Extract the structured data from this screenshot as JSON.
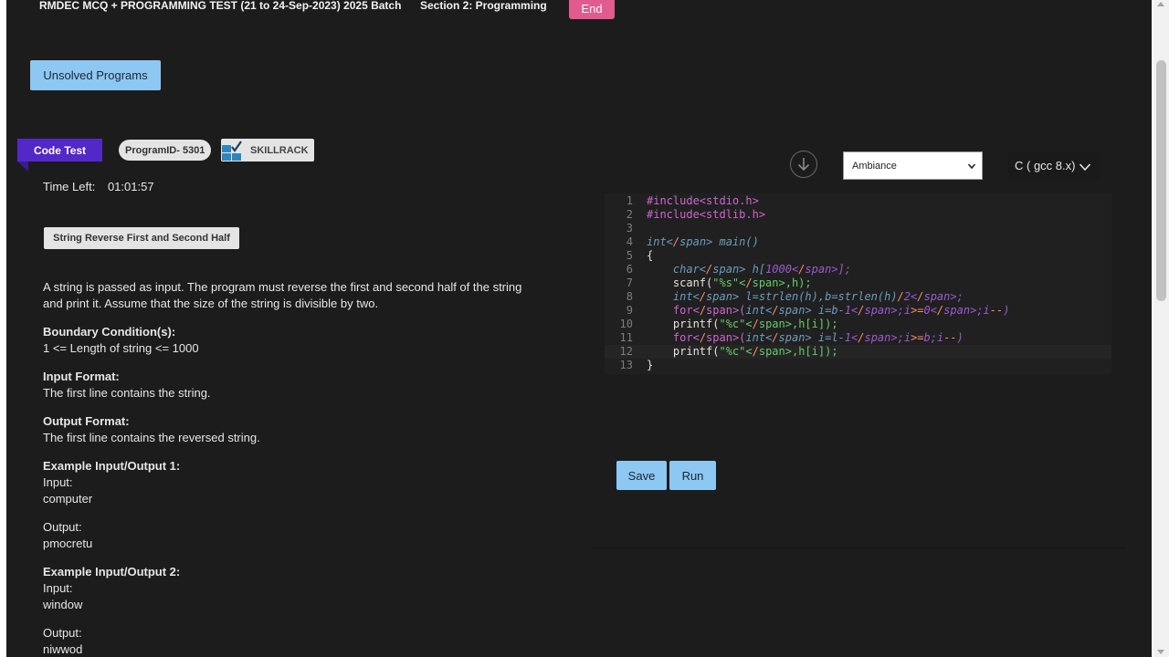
{
  "header": {
    "test_title": "RMDEC MCQ + PROGRAMMING TEST (21 to 24-Sep-2023) 2025 Batch",
    "section_title": "Section 2: Programming",
    "end_label": "End"
  },
  "unsolved_label": "Unsolved Programs",
  "tags": {
    "code_test": "Code Test",
    "program_id": "ProgramID- 5301",
    "skillrack": "SKILLRACK"
  },
  "timer": {
    "label": "Time Left:",
    "value": "01:01:57"
  },
  "problem": {
    "title": "String Reverse First and Second Half",
    "description_1": "A string is passed as input. The program must reverse the first and second half of the string",
    "description_2": "and print it. Assume that the size of the string is divisible by two.",
    "boundary_heading": "Boundary Condition(s):",
    "boundary_text": "1 <= Length of string <= 1000",
    "input_heading": "Input Format:",
    "input_text": "The first line contains the string.",
    "output_heading": "Output Format:",
    "output_text": "The first line contains the reversed string.",
    "example1_heading": "Example Input/Output 1:",
    "example1_input_label": "Input:",
    "example1_input": "computer",
    "example1_output_label": "Output:",
    "example1_output": "pmocretu",
    "example2_heading": "Example Input/Output 2:",
    "example2_input_label": "Input:",
    "example2_input": "window",
    "example2_output_label": "Output:",
    "example2_output": "niwwod"
  },
  "editor": {
    "theme": "Ambiance",
    "language": "C ( gcc 8.x)",
    "active_line": 12,
    "lines": [
      "#include<stdio.h>",
      "#include<stdlib.h>",
      "",
      "int main()",
      "{",
      "    char h[1000];",
      "    scanf(\"%s\",h);",
      "    int l=strlen(h),b=strlen(h)/2;",
      "    for(int i=b-1;i>=0;i--)",
      "    printf(\"%c\",h[i]);",
      "    for(int i=l-1;i>=b;i--)",
      "    printf(\"%c\",h[i]);",
      "}"
    ]
  },
  "actions": {
    "save_label": "Save",
    "run_label": "Run"
  },
  "icons": {
    "download": "download-icon",
    "chevron": "chevron-down-icon"
  }
}
